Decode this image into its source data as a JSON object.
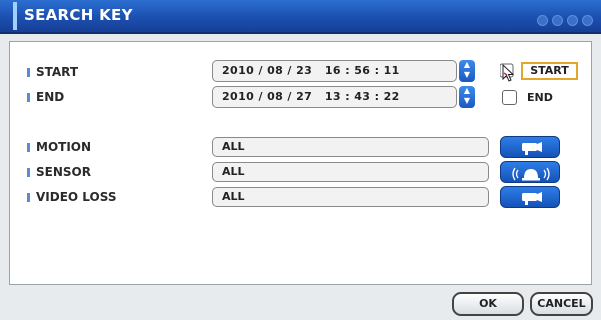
{
  "dialog": {
    "title": "SEARCH KEY"
  },
  "time": {
    "start_label": "START",
    "start_value": "2010 / 08 / 23   16 : 56 : 11",
    "start_checkbox_label": "START",
    "start_checked": true,
    "end_label": "END",
    "end_value": "2010 / 08 / 27   13 : 43 : 22",
    "end_checkbox_label": "END",
    "end_checked": false
  },
  "filters": {
    "motion_label": "MOTION",
    "motion_value": "ALL",
    "motion_icon": "camera-icon",
    "sensor_label": "SENSOR",
    "sensor_value": "ALL",
    "sensor_icon": "alarm-bell-icon",
    "video_loss_label": "VIDEO LOSS",
    "video_loss_value": "ALL",
    "video_loss_icon": "camera-icon"
  },
  "buttons": {
    "ok": "OK",
    "cancel": "CANCEL"
  },
  "colors": {
    "titlebar": "#1b4fb0",
    "accent_button": "#1f63cf",
    "highlight_border": "#e2a62a"
  }
}
